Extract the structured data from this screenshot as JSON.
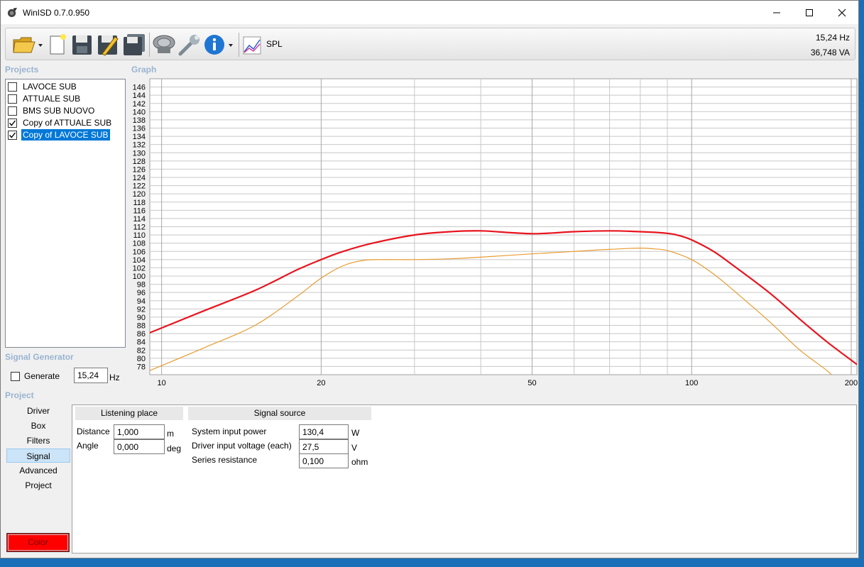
{
  "window": {
    "title": "WinISD 0.7.0.950"
  },
  "toolbar": {
    "icons": [
      "open-folder-icon",
      "new-document-icon",
      "save-icon",
      "save-as-icon",
      "save-all-icon",
      "driver-icon",
      "wrench-icon",
      "info-icon",
      "spl-graph-icon"
    ],
    "graph_selector_label": "SPL",
    "status_frequency": "15,24 Hz",
    "status_power": "36,748 VA"
  },
  "projects": {
    "label": "Projects",
    "items": [
      {
        "name": "LAVOCE SUB",
        "checked": false,
        "selected": false
      },
      {
        "name": "ATTUALE SUB",
        "checked": false,
        "selected": false
      },
      {
        "name": "BMS SUB NUOVO",
        "checked": false,
        "selected": false
      },
      {
        "name": "Copy of ATTUALE SUB",
        "checked": true,
        "selected": false
      },
      {
        "name": "Copy of LAVOCE SUB",
        "checked": true,
        "selected": true
      }
    ]
  },
  "graph": {
    "label": "Graph"
  },
  "chart_data": {
    "type": "line",
    "xscale": "log",
    "xlim": [
      9.5,
      205
    ],
    "ylim": [
      76,
      148
    ],
    "x_tick_labels": [
      "10",
      "20",
      "50",
      "100",
      "200"
    ],
    "x_ticks": [
      10,
      20,
      50,
      100,
      200
    ],
    "y_ticks": [
      78,
      80,
      82,
      84,
      86,
      88,
      90,
      92,
      94,
      96,
      98,
      100,
      102,
      104,
      106,
      108,
      110,
      112,
      114,
      116,
      118,
      120,
      122,
      124,
      126,
      128,
      130,
      132,
      134,
      136,
      138,
      140,
      142,
      144,
      146
    ],
    "grid": true,
    "series": [
      {
        "color": "#e8141e",
        "points": [
          [
            9.5,
            86.2
          ],
          [
            12,
            91.5
          ],
          [
            15,
            96.5
          ],
          [
            18,
            101.5
          ],
          [
            20,
            104
          ],
          [
            22,
            106
          ],
          [
            25,
            108
          ],
          [
            30,
            110
          ],
          [
            35,
            110.8
          ],
          [
            40,
            111
          ],
          [
            45,
            110.6
          ],
          [
            50,
            110.3
          ],
          [
            55,
            110.5
          ],
          [
            60,
            110.8
          ],
          [
            70,
            111
          ],
          [
            80,
            110.8
          ],
          [
            90,
            110.4
          ],
          [
            95,
            109.8
          ],
          [
            100,
            108.8
          ],
          [
            110,
            106
          ],
          [
            120,
            102.5
          ],
          [
            140,
            96
          ],
          [
            160,
            89.5
          ],
          [
            180,
            84
          ],
          [
            205,
            78.5
          ]
        ]
      },
      {
        "color": "#e89b30",
        "points": [
          [
            9.5,
            77
          ],
          [
            12,
            82.5
          ],
          [
            15,
            88
          ],
          [
            18,
            95
          ],
          [
            20,
            99.5
          ],
          [
            22,
            102.5
          ],
          [
            24,
            103.8
          ],
          [
            26,
            104
          ],
          [
            30,
            104
          ],
          [
            35,
            104.2
          ],
          [
            40,
            104.6
          ],
          [
            50,
            105.4
          ],
          [
            60,
            106
          ],
          [
            70,
            106.5
          ],
          [
            80,
            106.8
          ],
          [
            85,
            106.6
          ],
          [
            90,
            106.2
          ],
          [
            100,
            104
          ],
          [
            110,
            100.5
          ],
          [
            120,
            96.5
          ],
          [
            140,
            89
          ],
          [
            160,
            82
          ],
          [
            180,
            77
          ],
          [
            190,
            74
          ]
        ]
      }
    ]
  },
  "signal_generator": {
    "label": "Signal Generator",
    "generate_label": "Generate",
    "generate_checked": false,
    "frequency_value": "15,24",
    "frequency_unit": "Hz"
  },
  "project_section": {
    "label": "Project"
  },
  "nav": {
    "items": [
      "Driver",
      "Box",
      "Filters",
      "Signal",
      "Advanced",
      "Project"
    ],
    "active_index": 3
  },
  "color_button": {
    "label": "Color",
    "color": "#ff0000"
  },
  "listening_place": {
    "header": "Listening place",
    "distance_label": "Distance",
    "distance_value": "1,000",
    "distance_unit": "m",
    "angle_label": "Angle",
    "angle_value": "0,000",
    "angle_unit": "deg"
  },
  "signal_source": {
    "header": "Signal source",
    "power_label": "System input power",
    "power_value": "130,4",
    "power_unit": "W",
    "voltage_label": "Driver input voltage (each)",
    "voltage_value": "27,5",
    "voltage_unit": "V",
    "resistance_label": "Series resistance",
    "resistance_value": "0,100",
    "resistance_unit": "ohm"
  }
}
